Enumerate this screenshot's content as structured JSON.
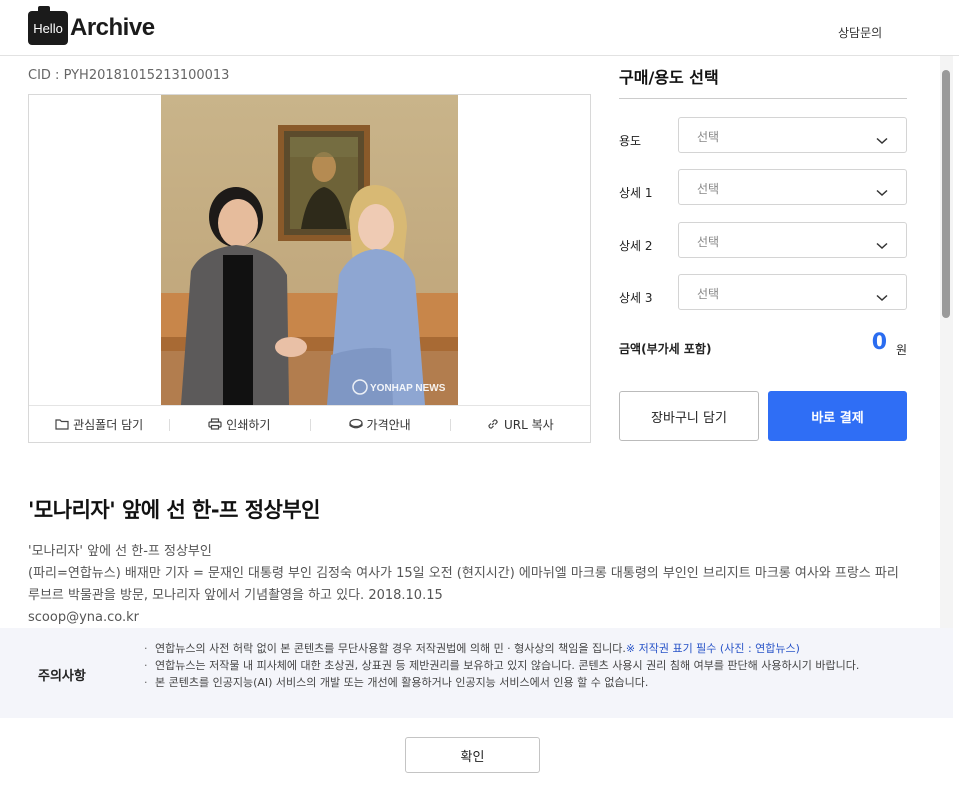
{
  "header": {
    "logo_box_text": "Hello",
    "logo_text": "Archive",
    "contact_label": "상담문의"
  },
  "content": {
    "cid": "CID : PYH20181015213100013",
    "photo_watermark": "YONHAP NEWS",
    "actions": [
      {
        "label": "관심폴더 담기",
        "icon": "folder-icon"
      },
      {
        "label": "인쇄하기",
        "icon": "printer-icon"
      },
      {
        "label": "가격안내",
        "icon": "price-tag-icon"
      },
      {
        "label": "URL 복사",
        "icon": "link-icon"
      }
    ],
    "headline": "'모나리자' 앞에 선 한-프 정상부인",
    "caption_lines": [
      "'모나리자' 앞에 선 한-프 정상부인",
      "(파리=연합뉴스) 배재만 기자 = 문재인 대통령 부인 김정숙 여사가 15일 오전 (현지시간) 에마뉘엘 마크롱 대통령의 부인인 브리지트 마크롱 여사와 프랑스 파리",
      "루브르 박물관을 방문, 모나리자 앞에서 기념촬영을 하고 있다. 2018.10.15",
      "scoop@yna.co.kr"
    ]
  },
  "panel": {
    "title": "구매/용도 선택",
    "fields": [
      {
        "label": "용도",
        "placeholder": "선택"
      },
      {
        "label": "상세 1",
        "placeholder": "선택"
      },
      {
        "label": "상세 2",
        "placeholder": "선택"
      },
      {
        "label": "상세 3",
        "placeholder": "선택"
      }
    ],
    "price_label": "금액(부가세 포함)",
    "price_value": "0",
    "price_unit": "원",
    "cart_button": "장바구니 담기",
    "pay_button": "바로 결제"
  },
  "notice": {
    "title": "주의사항",
    "item1_text": "연합뉴스의 사전 허락 없이 본 콘텐츠를 무단사용할 경우 저작권법에 의해 민 · 형사상의 책임을 집니다.",
    "item1_highlight": "※ 저작권 표기 필수 (사진 : 연합뉴스)",
    "item2_text": "연합뉴스는 저작물 내 피사체에 대한 초상권, 상표권 등 제반권리를 보유하고 있지 않습니다. 콘텐츠 사용시 권리 침해 여부를 판단해 사용하시기 바랍니다.",
    "item3_text": "본 콘텐츠를 인공지능(AI) 서비스의 개발 또는 개선에 활용하거나 인공지능 서비스에서 인용 할 수 없습니다."
  },
  "footer": {
    "ok_button": "확인"
  },
  "colors": {
    "accent": "#2f6ef5",
    "price": "#2a6cf0",
    "notice_bg": "#f4f5fa"
  }
}
